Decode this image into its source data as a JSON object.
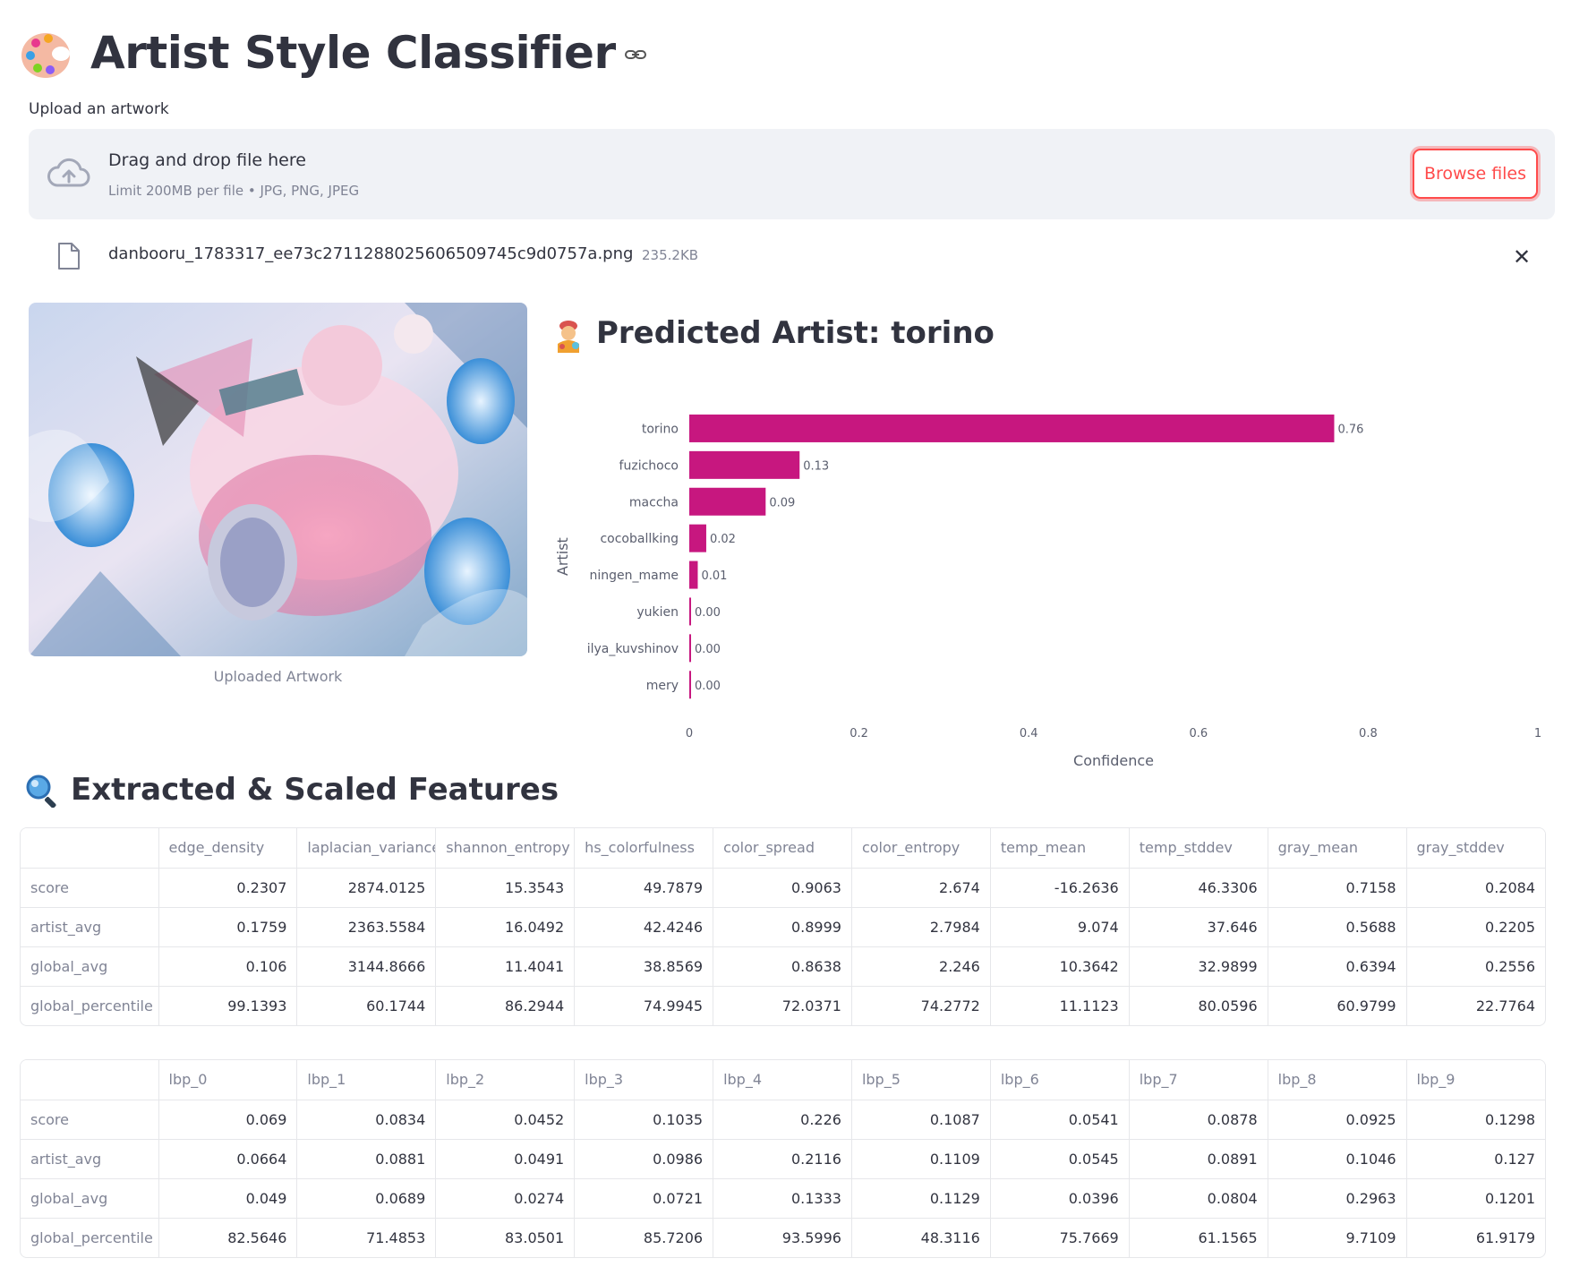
{
  "header": {
    "title": "Artist Style Classifier",
    "title_icon": "artist-palette-icon",
    "anchor_icon": "link-icon"
  },
  "uploader": {
    "label": "Upload an artwork",
    "drop_text": "Drag and drop file here",
    "limit_text": "Limit 200MB per file • JPG, PNG, JPEG",
    "browse_label": "Browse files",
    "file_name": "danbooru_1783317_ee73c2711288025606509745c9d0757a.png",
    "file_size": "235.2KB",
    "remove_icon": "close-icon",
    "accent_color": "#ff4b4b"
  },
  "artwork": {
    "caption": "Uploaded Artwork"
  },
  "prediction": {
    "icon": "artist-emoji-icon",
    "title": "Predicted Artist: torino"
  },
  "chart_data": {
    "type": "bar",
    "orientation": "horizontal",
    "categories": [
      "torino",
      "fuzichoco",
      "maccha",
      "cocoballking",
      "ningen_mame",
      "yukien",
      "ilya_kuvshinov",
      "mery"
    ],
    "values": [
      0.76,
      0.13,
      0.09,
      0.02,
      0.01,
      0.0,
      0.0,
      0.0
    ],
    "value_labels": [
      "0.76",
      "0.13",
      "0.09",
      "0.02",
      "0.01",
      "0.00",
      "0.00",
      "0.00"
    ],
    "xlabel": "Confidence",
    "ylabel": "Artist",
    "xlim": [
      0,
      1
    ],
    "xticks": [
      "0",
      "0.2",
      "0.4",
      "0.6",
      "0.8",
      "1"
    ],
    "bar_color": "#c7177f"
  },
  "features": {
    "icon": "magnifier-icon",
    "title": "Extracted & Scaled Features",
    "table1": {
      "columns": [
        "edge_density",
        "laplacian_variance",
        "shannon_entropy",
        "hs_colorfulness",
        "color_spread",
        "color_entropy",
        "temp_mean",
        "temp_stddev",
        "gray_mean",
        "gray_stddev"
      ],
      "rows": [
        {
          "label": "score",
          "values": [
            "0.2307",
            "2874.0125",
            "15.3543",
            "49.7879",
            "0.9063",
            "2.674",
            "-16.2636",
            "46.3306",
            "0.7158",
            "0.2084"
          ]
        },
        {
          "label": "artist_avg",
          "values": [
            "0.1759",
            "2363.5584",
            "16.0492",
            "42.4246",
            "0.8999",
            "2.7984",
            "9.074",
            "37.646",
            "0.5688",
            "0.2205"
          ]
        },
        {
          "label": "global_avg",
          "values": [
            "0.106",
            "3144.8666",
            "11.4041",
            "38.8569",
            "0.8638",
            "2.246",
            "10.3642",
            "32.9899",
            "0.6394",
            "0.2556"
          ]
        },
        {
          "label": "global_percentile",
          "values": [
            "99.1393",
            "60.1744",
            "86.2944",
            "74.9945",
            "72.0371",
            "74.2772",
            "11.1123",
            "80.0596",
            "60.9799",
            "22.7764"
          ]
        }
      ]
    },
    "table2": {
      "columns": [
        "lbp_0",
        "lbp_1",
        "lbp_2",
        "lbp_3",
        "lbp_4",
        "lbp_5",
        "lbp_6",
        "lbp_7",
        "lbp_8",
        "lbp_9"
      ],
      "rows": [
        {
          "label": "score",
          "values": [
            "0.069",
            "0.0834",
            "0.0452",
            "0.1035",
            "0.226",
            "0.1087",
            "0.0541",
            "0.0878",
            "0.0925",
            "0.1298"
          ]
        },
        {
          "label": "artist_avg",
          "values": [
            "0.0664",
            "0.0881",
            "0.0491",
            "0.0986",
            "0.2116",
            "0.1109",
            "0.0545",
            "0.0891",
            "0.1046",
            "0.127"
          ]
        },
        {
          "label": "global_avg",
          "values": [
            "0.049",
            "0.0689",
            "0.0274",
            "0.0721",
            "0.1333",
            "0.1129",
            "0.0396",
            "0.0804",
            "0.2963",
            "0.1201"
          ]
        },
        {
          "label": "global_percentile",
          "values": [
            "82.5646",
            "71.4853",
            "83.0501",
            "85.7206",
            "93.5996",
            "48.3116",
            "75.7669",
            "61.1565",
            "9.7109",
            "61.9179"
          ]
        }
      ]
    }
  }
}
